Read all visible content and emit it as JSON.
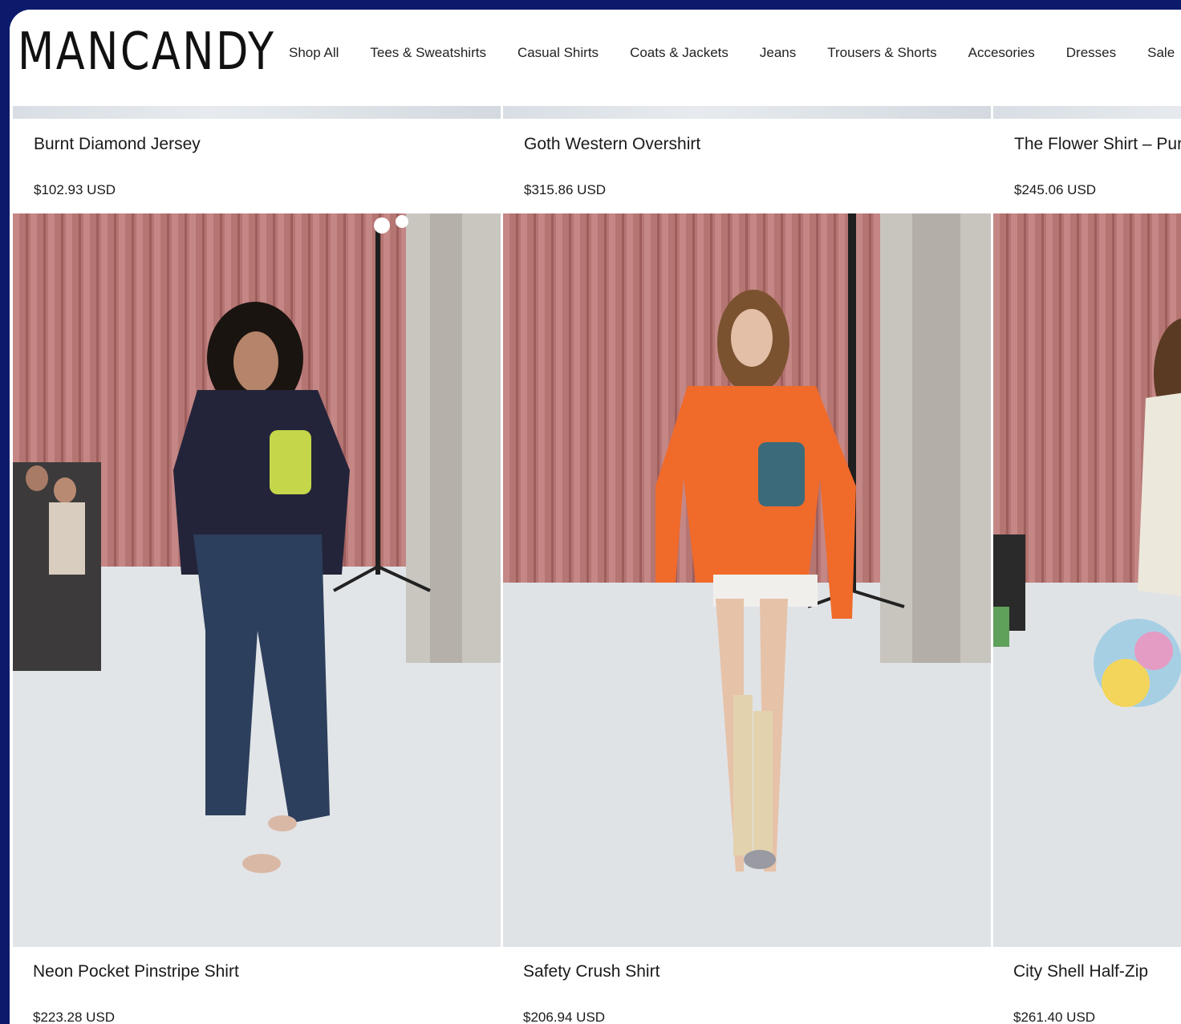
{
  "brand": {
    "logo": "MANCANDY"
  },
  "nav": {
    "items": [
      "Shop All",
      "Tees & Sweatshirts",
      "Casual Shirts",
      "Coats & Jackets",
      "Jeans",
      "Trousers & Shorts",
      "Accesories",
      "Dresses",
      "Sale"
    ]
  },
  "products": {
    "top": [
      {
        "title": "Burnt Diamond Jersey",
        "price": "$102.93 USD"
      },
      {
        "title": "Goth Western Overshirt",
        "price": "$315.86 USD"
      },
      {
        "title": "The Flower Shirt – Purp",
        "price": "$245.06 USD"
      }
    ],
    "bottom": [
      {
        "title": "Neon Pocket Pinstripe Shirt",
        "price": "$223.28 USD"
      },
      {
        "title": "Safety Crush Shirt",
        "price": "$206.94 USD"
      },
      {
        "title": "City Shell Half-Zip",
        "price": "$261.40 USD"
      }
    ]
  },
  "colors": {
    "page_bg": "#0c1a6b",
    "curtain": "#b97a78",
    "floor": "#dfe2e5",
    "orange_shirt": "#f06a2a",
    "neon_pocket": "#c5d64a"
  }
}
